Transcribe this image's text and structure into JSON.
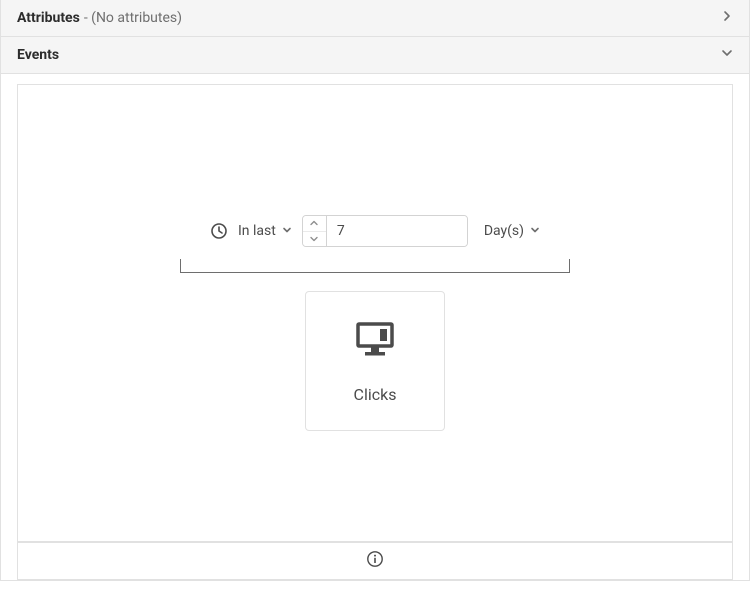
{
  "attributes": {
    "title": "Attributes",
    "subtitle": "- (No attributes)"
  },
  "events": {
    "title": "Events",
    "time": {
      "rangeLabel": "In last",
      "value": "7",
      "unit": "Day(s)"
    },
    "card": {
      "label": "Clicks"
    }
  }
}
